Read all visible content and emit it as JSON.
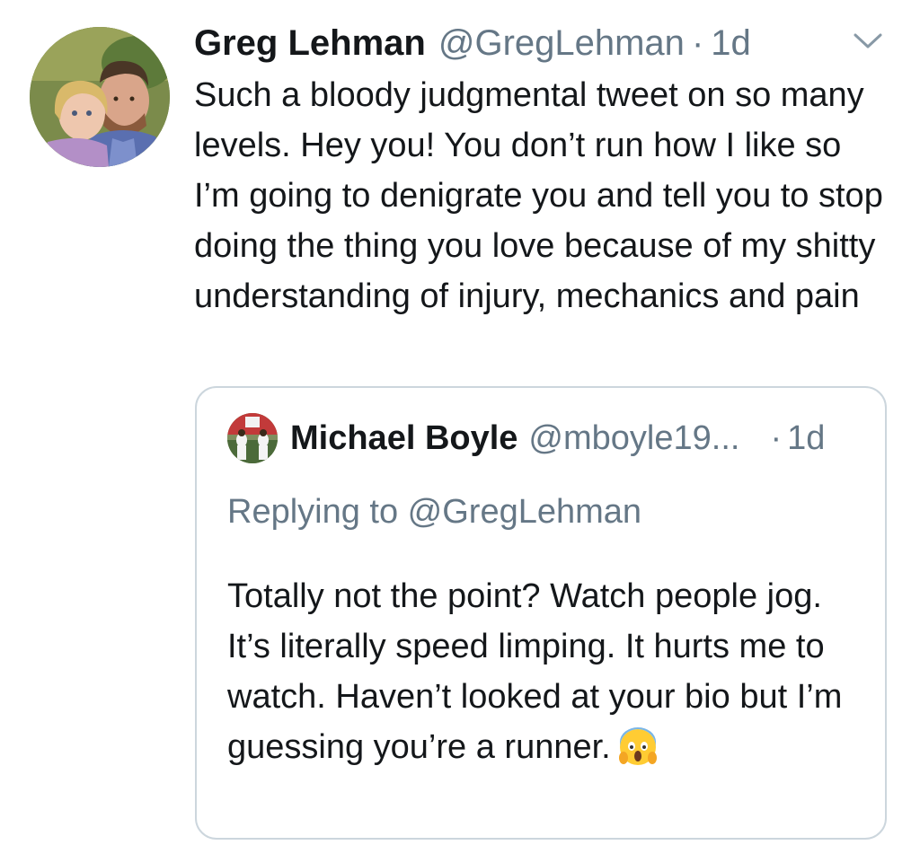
{
  "tweet": {
    "author_name": "Greg Lehman",
    "author_handle": "@GregLehman",
    "separator": "·",
    "time": "1d",
    "menu_icon": "chevron-down-icon",
    "text": "Such a bloody judgmental tweet on so many levels. Hey you! You don’t run how I like so I’m going to denigrate you and tell you to stop doing the thing you love because of my shitty understanding of injury, mechanics and pain"
  },
  "quoted_tweet": {
    "author_name": "Michael Boyle",
    "author_handle": "@mboyle19...",
    "separator": "·",
    "time": "1d",
    "replying_to": "Replying to @GregLehman",
    "text": "Totally not the point? Watch people jog. It’s literally speed limping. It hurts me to watch. Haven’t looked at your bio but I’m guessing you’re a runner.",
    "emoji_icon": "face-screaming-in-fear-icon"
  },
  "colors": {
    "text": "#14171a",
    "secondary": "#657786",
    "border": "#ccd6dd",
    "background": "#ffffff"
  }
}
